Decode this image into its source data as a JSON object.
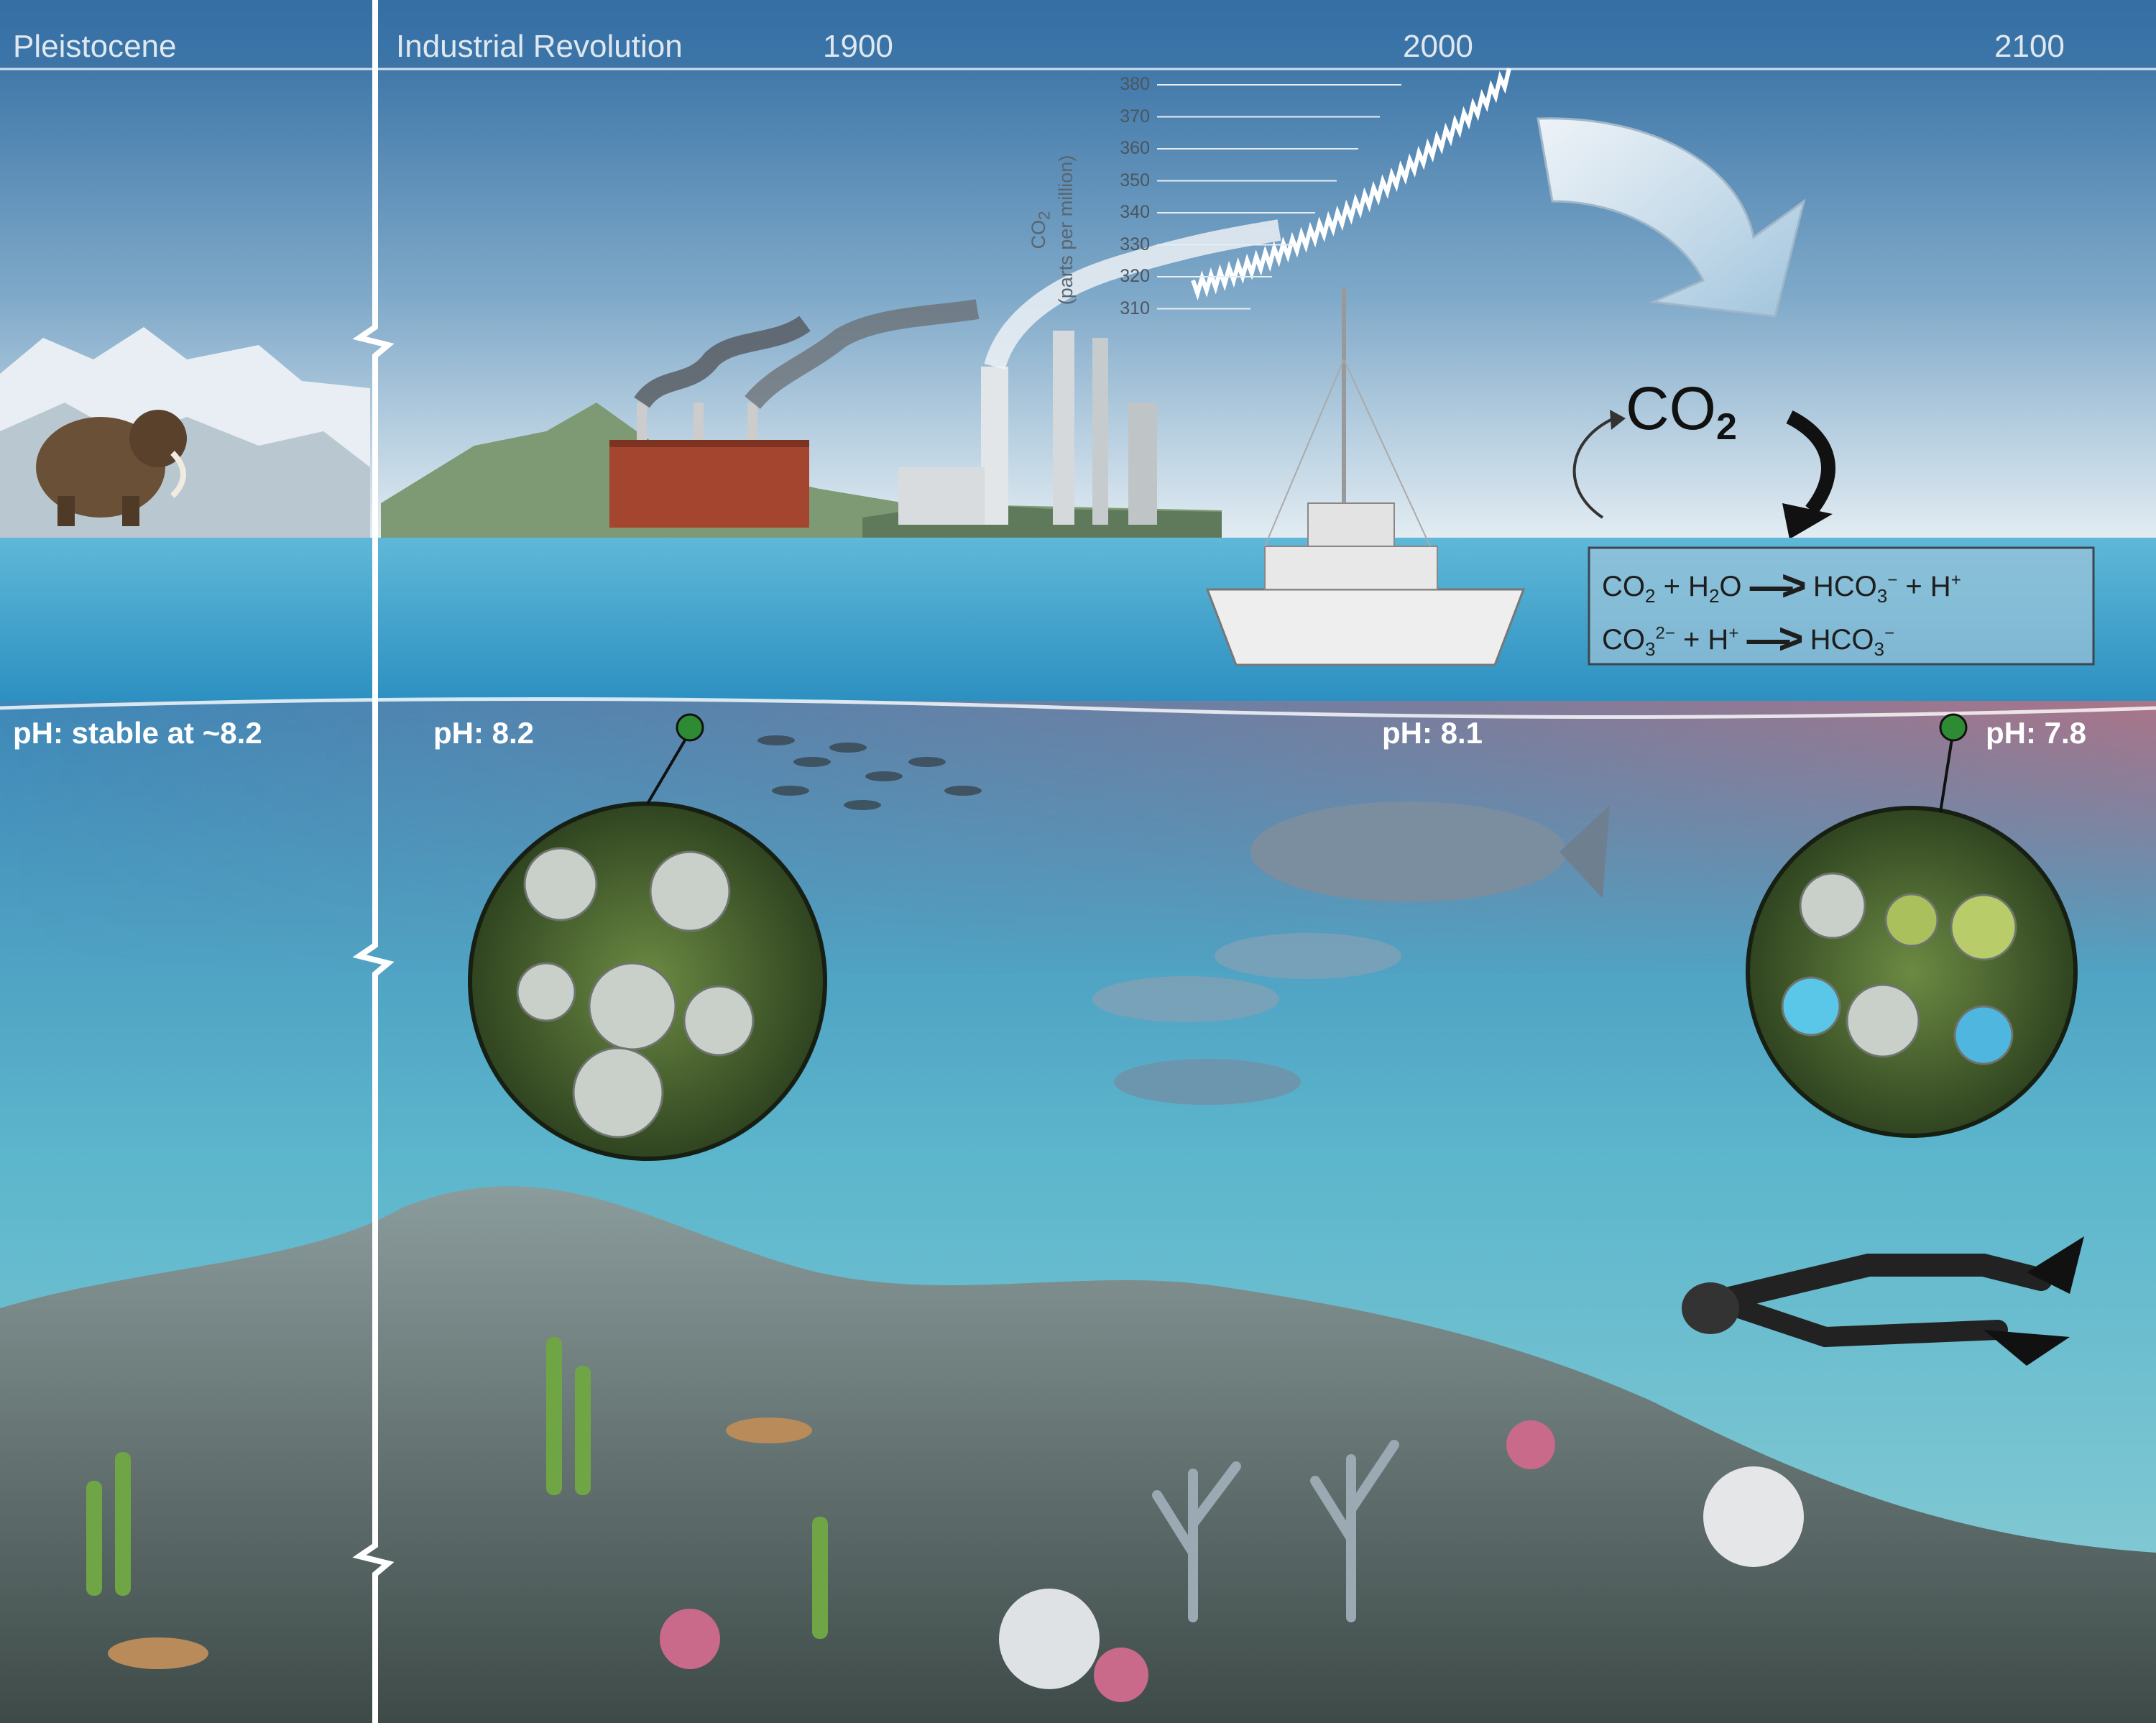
{
  "timeline": {
    "eras": [
      "Pleistocene",
      "Industrial Revolution"
    ],
    "years": [
      "1900",
      "2000",
      "2100"
    ]
  },
  "ph_labels": {
    "pleistocene": "pH: stable at ~8.2",
    "industrial": "pH: 8.2",
    "present": "pH: 8.1",
    "future": "pH: 7.8"
  },
  "co2_graph": {
    "axis_label_line1": "CO",
    "axis_label_sub": "2",
    "axis_label_line2": "(parts per million)",
    "ticks": [
      "380",
      "370",
      "360",
      "350",
      "340",
      "330",
      "320",
      "310"
    ]
  },
  "co2_label": {
    "text": "CO",
    "sub": "2"
  },
  "equations": {
    "eq1": {
      "a": "CO",
      "a_sub": "2",
      "plus1": " + H",
      "b_sub": "2",
      "b_end": "O",
      "prod": "HCO",
      "prod_sub": "3",
      "prod_sup": "−",
      "plus2": " + H",
      "h_sup": "+"
    },
    "eq2": {
      "a": "CO",
      "a_sub": "3",
      "a_sup": "2−",
      "plus1": " + H",
      "h_sup": "+",
      "prod": "HCO",
      "prod_sub": "3",
      "prod_sup": "−"
    }
  },
  "colors": {
    "sky_top": "#2f6fa3",
    "sky_bottom": "#dbe7ef",
    "sea_surface": "#3fa8cf",
    "acid_tint": "#c86a7a",
    "deep_water": "#56b3c8",
    "plankton_bg": "#3f5a2a",
    "marker_green": "#2e8b34"
  }
}
